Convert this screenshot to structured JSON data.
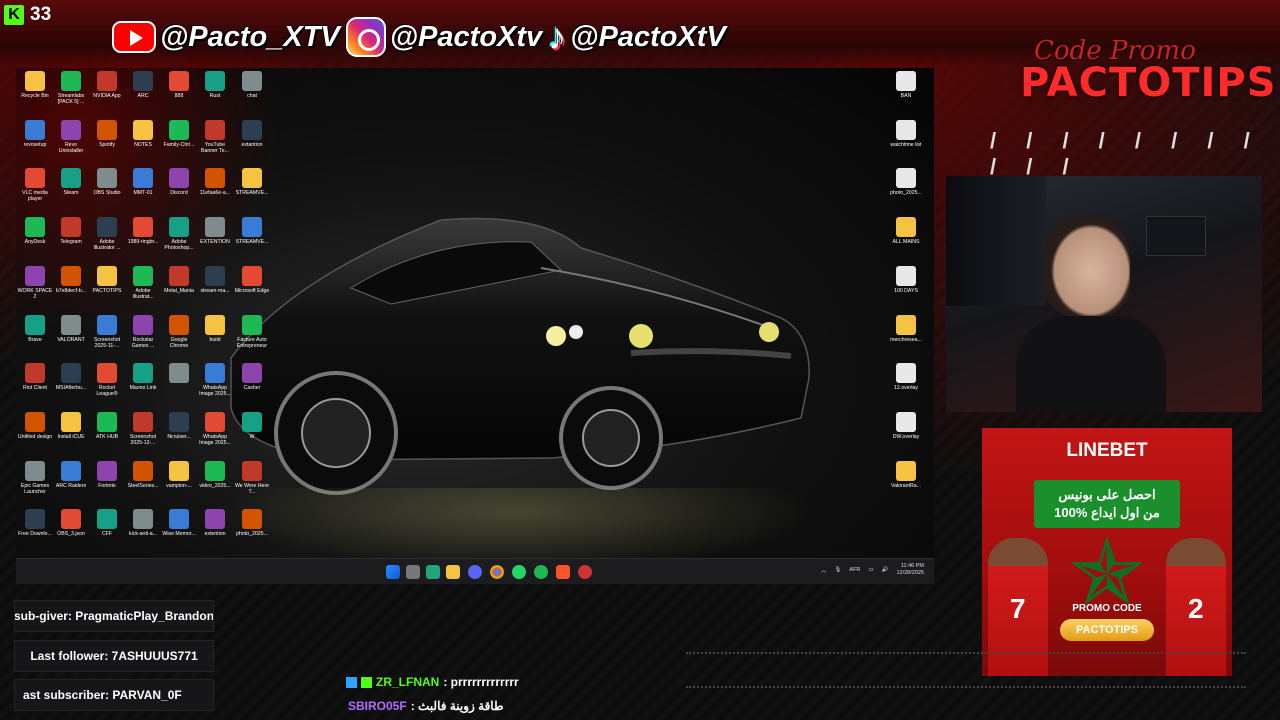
{
  "kick": {
    "logo": "K",
    "viewers": "33"
  },
  "socials": [
    {
      "icon": "youtube-icon",
      "handle": "@Pacto_XTV"
    },
    {
      "icon": "instagram-icon",
      "handle": "@PactoXtv"
    },
    {
      "icon": "tiktok-icon",
      "handle": "@PactoXtV"
    }
  ],
  "promo": {
    "top": "Code Promo",
    "main": "PACTOTIPS",
    "slashes": "/ / / / / / / / / / /"
  },
  "desktop_icons": {
    "col1": [
      "Recycle Bin",
      "revosetup",
      "VLC media player",
      "AnyDesk",
      "WORK SPACE 2",
      "Brave",
      "Riot Client",
      "Untitled design",
      "Epic Games Launcher",
      "Free Downlo..."
    ],
    "col2": [
      "Streamlabs [PACK 5] ...",
      "Revo Uninstaller",
      "Steam",
      "Telegram",
      "b7e8decf-b...",
      "VALORANT",
      "MSIAfterbu...",
      "Install iCUE",
      "ARC Raiders",
      "OBS_3.json"
    ],
    "col3": [
      "NVIDIA App",
      "Spotify",
      "OBS Studio",
      "Adobe Illustrator ...",
      "PACTOTIPS",
      "Screenshot 2025-11-...",
      "Rocket League®",
      "ATK HUB",
      "Fortnite",
      "CFF"
    ],
    "col4": [
      "ARC",
      "NOTES",
      "MMT-01",
      "1989-ringbr...",
      "Adobe Illustrat...",
      "Rockstar Games ...",
      "Maono Link",
      "Screenshot 2025-12-...",
      "SteelSeries...",
      "kick-anti-a..."
    ],
    "col5": [
      "888",
      "Family-Chri...",
      "Discord",
      "Adobe Photoshop...",
      "Metal_Mania",
      "Google Chrome",
      "",
      "Ncruiser...",
      "vampion-...",
      "Wise Memor..."
    ],
    "col6": [
      "Rust",
      "YouTube Banner Te...",
      "11efaa6e-a...",
      "EXTENTION",
      "stream-ma...",
      "build",
      "WhatsApp Image 2025...",
      "WhatsApp Image 2025...",
      "video_2025...",
      "extention"
    ],
    "col7": [
      "chat",
      "extantion",
      "STREAMVE...",
      "STREAMVE...",
      "Microsoft Edge",
      "Facture Auto Entrepreneur",
      "Casher",
      "W",
      "We Were Here T...",
      "photo_2025..."
    ],
    "right": [
      "BAN",
      "watchtime list",
      "photo_2025...",
      "ALL MAINS",
      "100 DAYS",
      "merchresea...",
      "12.overlay",
      "DW.overlay",
      "ValorantRa..."
    ]
  },
  "taskbar": {
    "lang": "AFR",
    "time": "11:46 PM",
    "date": "12/28/2025"
  },
  "ad": {
    "logo": "LINEBET",
    "banner_line1": "احصل على بونيس",
    "banner_line2": "100% من اول ايداع",
    "promo_label": "PROMO CODE",
    "promo_code": "PACTOTIPS",
    "player_left": "7",
    "player_right": "2"
  },
  "stream_info": {
    "sub_giver": "sub-giver: PragmaticPlay_Brandon",
    "last_follower": "Last follower: 7ASHUUUS771",
    "last_subscriber": "ast subscriber: PARVAN_0F"
  },
  "chat": [
    {
      "user": "ZR_LFNAN",
      "message": ": prrrrrrrrrrrrr",
      "color": "#53fc18"
    },
    {
      "user": "SBIRO05F",
      "message": ": طاقة زوينة فالبث",
      "color": "#b36bff"
    }
  ],
  "colors": {
    "accent_red": "#ff2a2a",
    "kick_green": "#53fc18"
  }
}
